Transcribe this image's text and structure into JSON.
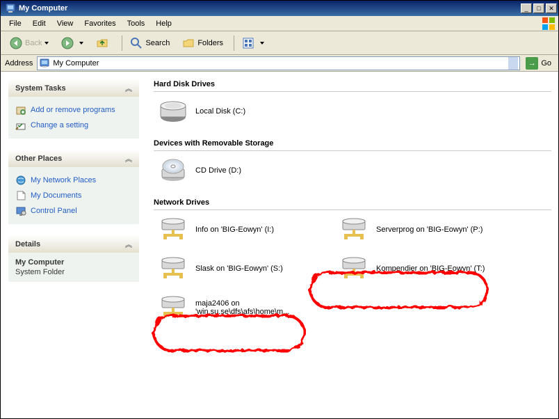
{
  "window": {
    "title": "My Computer"
  },
  "menubar": [
    "File",
    "Edit",
    "View",
    "Favorites",
    "Tools",
    "Help"
  ],
  "toolbar": {
    "back": "Back",
    "search": "Search",
    "folders": "Folders"
  },
  "addressbar": {
    "label": "Address",
    "value": "My Computer",
    "go": "Go"
  },
  "sidebar": {
    "system_tasks": {
      "title": "System Tasks",
      "items": [
        {
          "label": "Add or remove programs",
          "icon": "addremove-ico"
        },
        {
          "label": "Change a setting",
          "icon": "setting-ico"
        }
      ]
    },
    "other_places": {
      "title": "Other Places",
      "items": [
        {
          "label": "My Network Places",
          "icon": "netplaces-ico"
        },
        {
          "label": "My Documents",
          "icon": "mydocs-ico"
        },
        {
          "label": "Control Panel",
          "icon": "cpl-ico"
        }
      ]
    },
    "details": {
      "title": "Details",
      "name": "My Computer",
      "type": "System Folder"
    }
  },
  "main": {
    "sections": {
      "hdd": {
        "title": "Hard Disk Drives",
        "items": [
          {
            "label": "Local Disk (C:)"
          }
        ]
      },
      "removable": {
        "title": "Devices with Removable Storage",
        "items": [
          {
            "label": "CD Drive (D:)"
          }
        ]
      },
      "network": {
        "title": "Network Drives",
        "items": [
          {
            "label": "Info on 'BIG-Eowyn' (I:)"
          },
          {
            "label": "Serverprog on 'BIG-Eowyn' (P:)"
          },
          {
            "label": "Slask on 'BIG-Eowyn' (S:)"
          },
          {
            "label": "Kompendier on 'BIG-Eowyn' (T:)"
          },
          {
            "label": "maja2406 on 'win.su.se\\dfs\\afs\\home\\m..."
          }
        ]
      }
    }
  }
}
